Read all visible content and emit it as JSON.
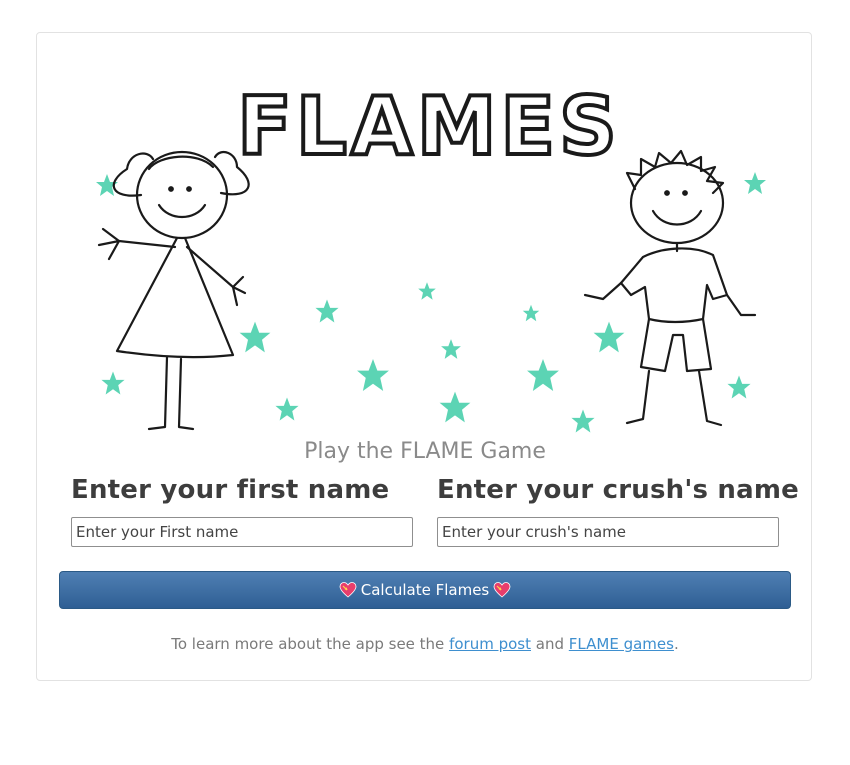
{
  "hero": {
    "title": "FLAMES",
    "subtitle": "Play the FLAME Game"
  },
  "form": {
    "first_name_label": "Enter your first name",
    "first_name_placeholder": "Enter your First name",
    "first_name_value": "",
    "crush_name_label": "Enter your crush's name",
    "crush_name_placeholder": "Enter your crush's name",
    "crush_name_value": "",
    "calculate_label": "Calculate Flames"
  },
  "footer": {
    "prefix": "To learn more about the app see the",
    "link1": "forum post",
    "joiner": "and",
    "link2": "FLAME games",
    "suffix": "."
  },
  "colors": {
    "star": "#5cd4b4",
    "button": "#3c6ea3",
    "link": "#3e8fcf"
  }
}
